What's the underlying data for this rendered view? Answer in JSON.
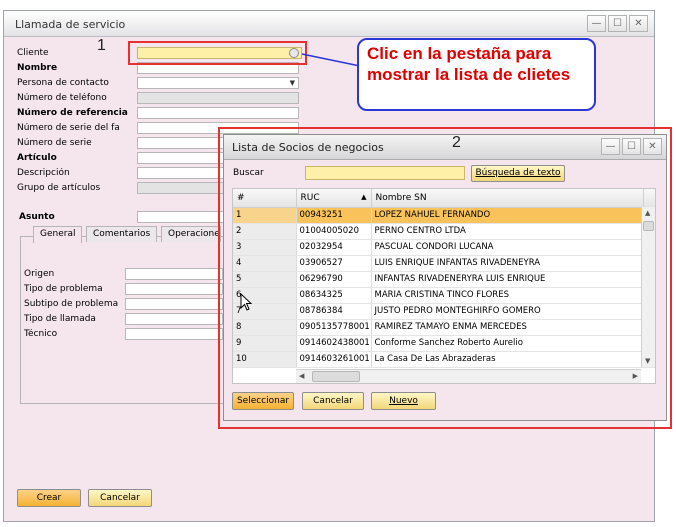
{
  "main_window": {
    "title": "Llamada de servicio",
    "controls": {
      "minimize": "—",
      "maximize": "☐",
      "close": "✕"
    },
    "fields": [
      {
        "label": "Cliente",
        "bold": false
      },
      {
        "label": "Nombre",
        "bold": true
      },
      {
        "label": "Persona de contacto",
        "bold": false
      },
      {
        "label": "Número de teléfono",
        "bold": false
      },
      {
        "label": "Número de referencia",
        "bold": true
      },
      {
        "label": "Número de serie del fabricante",
        "bold": false
      },
      {
        "label": "Número de serie",
        "bold": false
      },
      {
        "label": "Artículo",
        "bold": true
      },
      {
        "label": "Descripción",
        "bold": false
      },
      {
        "label": "Grupo de artículos",
        "bold": false
      }
    ],
    "asunto_label": "Asunto",
    "tabs": [
      "General",
      "Comentarios",
      "Operaciones"
    ],
    "general_fields": [
      "Origen",
      "Tipo de problema",
      "Subtipo de problema",
      "Tipo de llamada",
      "Técnico"
    ],
    "buttons": {
      "create": "Crear",
      "cancel": "Cancelar"
    }
  },
  "callout": {
    "step1": "1",
    "step2": "2",
    "text": "Clic en la pestaña para mostrar la lista de clietes"
  },
  "dialog": {
    "title": "Lista de Socios de negocios",
    "search_label": "Buscar",
    "search_value": "",
    "search_button": "Búsqueda de texto",
    "columns": {
      "num": "#",
      "ruc": "RUC",
      "name": "Nombre SN"
    },
    "rows": [
      {
        "n": "1",
        "ruc": "00943251",
        "name": "LOPEZ NAHUEL FERNANDO"
      },
      {
        "n": "2",
        "ruc": "01004005020",
        "name": "PERNO CENTRO  LTDA"
      },
      {
        "n": "3",
        "ruc": "02032954",
        "name": "PASCUAL CONDORI LUCANA"
      },
      {
        "n": "4",
        "ruc": "03906527",
        "name": "LUIS ENRIQUE INFANTAS RIVADENEYRA"
      },
      {
        "n": "5",
        "ruc": "06296790",
        "name": "INFANTAS RIVADENERYRA LUIS ENRIQUE"
      },
      {
        "n": "6",
        "ruc": "08634325",
        "name": "MARIA CRISTINA TINCO FLORES"
      },
      {
        "n": "7",
        "ruc": "08786384",
        "name": "JUSTO PEDRO MONTEGHIRFO GOMERO"
      },
      {
        "n": "8",
        "ruc": "0905135778001",
        "name": "RAMIREZ TAMAYO ENMA MERCEDES"
      },
      {
        "n": "9",
        "ruc": "0914602438001",
        "name": "Conforme Sanchez Roberto Aurelio"
      },
      {
        "n": "10",
        "ruc": "0914603261001",
        "name": "La Casa De Las Abrazaderas"
      }
    ],
    "buttons": {
      "select": "Seleccionar",
      "cancel": "Cancelar",
      "new": "Nuevo"
    }
  }
}
